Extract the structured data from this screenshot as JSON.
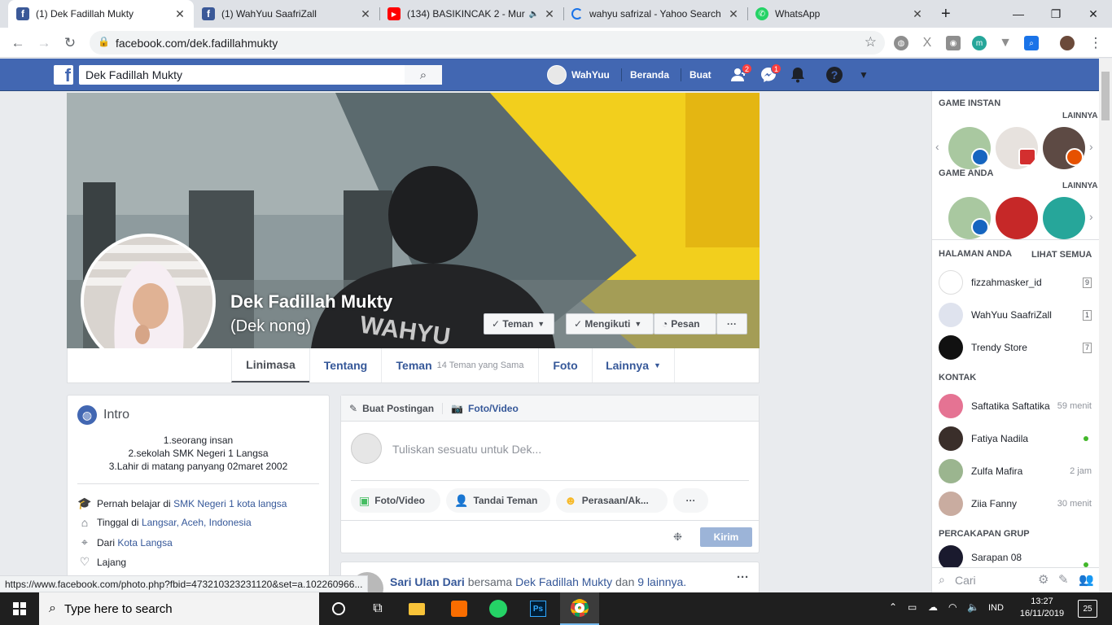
{
  "browser": {
    "tabs": [
      {
        "title": "(1) Dek Fadillah Mukty",
        "icon": "facebook-icon",
        "active": true
      },
      {
        "title": "(1) WahYuu SaafriZall",
        "icon": "facebook-icon",
        "active": false
      },
      {
        "title": "(134) BASIKINCAK 2 - Mur",
        "icon": "youtube-icon",
        "active": false
      },
      {
        "title": "wahyu safrizal - Yahoo Search R",
        "icon": "loading-icon",
        "active": false
      },
      {
        "title": "WhatsApp",
        "icon": "whatsapp-icon",
        "active": false
      }
    ],
    "new_tab": "+",
    "url": "facebook.com/dek.fadillahmukty",
    "status_url": "https://www.facebook.com/photo.php?fbid=473210323231120&set=a.102260966..."
  },
  "fb_header": {
    "search_value": "Dek Fadillah Mukty",
    "user_name": "WahYuu",
    "home_label": "Beranda",
    "create_label": "Buat",
    "friend_requests_badge": "2",
    "messages_badge": "1"
  },
  "profile": {
    "name": "Dek Fadillah Mukty",
    "nickname": "(Dek nong)",
    "friend_button": "Teman",
    "follow_button": "Mengikuti",
    "message_button": "Pesan",
    "more_button": "···",
    "tabs": {
      "timeline": "Linimasa",
      "about": "Tentang",
      "friends": "Teman",
      "friends_mutual": "14 Teman yang Sama",
      "photos": "Foto",
      "more": "Lainnya"
    }
  },
  "intro": {
    "title": "Intro",
    "bio": [
      "1.seorang insan",
      "2.sekolah SMK Negeri 1 Langsa",
      "3.Lahir di matang panyang 02maret 2002"
    ],
    "studied_prefix": "Pernah belajar di",
    "studied_link": "SMK Negeri 1 kota langsa",
    "lives_prefix": "Tinggal di",
    "lives_link": "Langsar, Aceh, Indonesia",
    "from_prefix": "Dari",
    "from_link": "Kota Langsa",
    "relationship": "Lajang"
  },
  "composer": {
    "create_post": "Buat Postingan",
    "photo_video_tab": "Foto/Video",
    "placeholder": "Tuliskan sesuatu untuk Dek...",
    "photo_video": "Foto/Video",
    "tag_friends": "Tandai Teman",
    "feeling": "Perasaan/Ak...",
    "more": "···",
    "send": "Kirim"
  },
  "feed_post": {
    "author": "Sari Ulan Dari",
    "with_text": "bersama",
    "tagged": "Dek Fadillah Mukty",
    "and_text": "dan",
    "others": "9 lainnya.",
    "more": "···"
  },
  "sidebar": {
    "instant_games": "GAME INSTAN",
    "more1": "LAINNYA",
    "your_games": "GAME ANDA",
    "more2": "LAINNYA",
    "your_pages": "HALAMAN ANDA",
    "see_all": "LIHAT SEMUA",
    "pages": [
      {
        "name": "fizzahmasker_id",
        "count": "9"
      },
      {
        "name": "WahYuu SaafriZall",
        "count": "1"
      },
      {
        "name": "Trendy Store",
        "count": "7"
      }
    ],
    "contacts_title": "KONTAK",
    "contacts": [
      {
        "name": "Saftatika Saftatika",
        "status": "59 menit"
      },
      {
        "name": "Fatiya Nadila",
        "status": ""
      },
      {
        "name": "Zulfa Mafira",
        "status": "2 jam"
      },
      {
        "name": "Ziia Fanny",
        "status": "30 menit"
      }
    ],
    "groups_title": "PERCAKAPAN GRUP",
    "groups": [
      {
        "name": "Sarapan 08"
      }
    ],
    "chat_search": "Cari"
  },
  "taskbar": {
    "search": "Type here to search",
    "lang": "IND",
    "time": "13:27",
    "date": "16/11/2019",
    "notif_count": "25"
  },
  "colors": {
    "fb_blue": "#4267b2",
    "link": "#365899",
    "online": "#42b72a",
    "badge": "#fa3e3e"
  }
}
